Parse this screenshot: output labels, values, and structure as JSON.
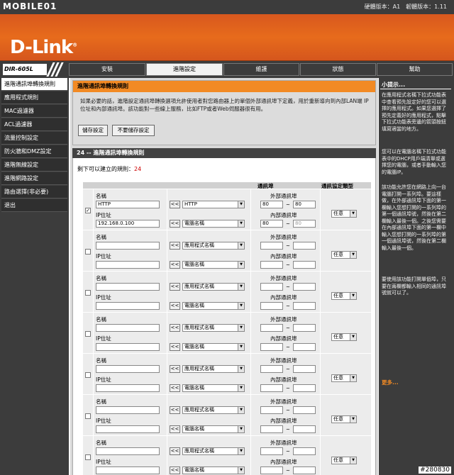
{
  "watermark": "MOBILE01",
  "version_text": "硬體版本：A1　韌體版本：1.11",
  "logo": "D-Link",
  "model": "DIR-605L",
  "tabs": [
    {
      "label": "安裝",
      "active": false
    },
    {
      "label": "進階設定",
      "active": true
    },
    {
      "label": "維護",
      "active": false
    },
    {
      "label": "狀態",
      "active": false
    },
    {
      "label": "幫助",
      "active": false
    }
  ],
  "sidebar": [
    {
      "label": "進階通訊埠轉換規則",
      "active": true
    },
    {
      "label": "應用程式規則",
      "active": false
    },
    {
      "label": "MAC過濾器",
      "active": false
    },
    {
      "label": "ACL過濾器",
      "active": false
    },
    {
      "label": "流量控制設定",
      "active": false
    },
    {
      "label": "防火牆和DMZ設定",
      "active": false
    },
    {
      "label": "進階無線設定",
      "active": false
    },
    {
      "label": "進階網路設定",
      "active": false
    },
    {
      "label": "路由選擇(非必要)",
      "active": false
    },
    {
      "label": "退出",
      "active": false
    }
  ],
  "section1": {
    "title": "進階通訊埠轉換規則",
    "text": "如果必要的話，進階設定通訊埠轉換選項允許使用者對您路由器上的單個外部通訊埠下定義，用於重新導向到內部LAN端 IP位址和內部通訊埠。該功能對一些線上服務，比如FTP或者Web伺服器很有用。",
    "save_label": "儲存設定",
    "nosave_label": "不要儲存設定"
  },
  "section2": {
    "title": "24 -- 進階通訊埠轉換規則",
    "remaining_label": "剩下可以建立的規則：",
    "remaining_count": "24",
    "head_ports": "通訊埠",
    "head_type": "通訊協定類型"
  },
  "labels": {
    "name": "名稱",
    "ip": "IP位址",
    "ext_port": "外部通訊埠",
    "int_port": "內部通訊埠",
    "arrow": "<<",
    "tilde": "~"
  },
  "rules": [
    {
      "checked": true,
      "name": "HTTP",
      "ip": "192.168.0.100",
      "app": "HTTP",
      "computer": "電腦名稱",
      "ext_start": "80",
      "ext_end": "80",
      "int_start": "80",
      "int_end": "80",
      "protocol": "任意"
    },
    {
      "checked": false,
      "name": "",
      "ip": "",
      "app": "應用程式名稱",
      "computer": "電腦名稱",
      "ext_start": "",
      "ext_end": "",
      "int_start": "",
      "int_end": "",
      "protocol": "任意"
    },
    {
      "checked": false,
      "name": "",
      "ip": "",
      "app": "應用程式名稱",
      "computer": "電腦名稱",
      "ext_start": "",
      "ext_end": "",
      "int_start": "",
      "int_end": "",
      "protocol": "任意"
    },
    {
      "checked": false,
      "name": "",
      "ip": "",
      "app": "應用程式名稱",
      "computer": "電腦名稱",
      "ext_start": "",
      "ext_end": "",
      "int_start": "",
      "int_end": "",
      "protocol": "任意"
    },
    {
      "checked": false,
      "name": "",
      "ip": "",
      "app": "應用程式名稱",
      "computer": "電腦名稱",
      "ext_start": "",
      "ext_end": "",
      "int_start": "",
      "int_end": "",
      "protocol": "任意"
    },
    {
      "checked": false,
      "name": "",
      "ip": "",
      "app": "應用程式名稱",
      "computer": "電腦名稱",
      "ext_start": "",
      "ext_end": "",
      "int_start": "",
      "int_end": "",
      "protocol": "任意"
    },
    {
      "checked": false,
      "name": "",
      "ip": "",
      "app": "應用程式名稱",
      "computer": "電腦名稱",
      "ext_start": "",
      "ext_end": "",
      "int_start": "",
      "int_end": "",
      "protocol": "任意"
    }
  ],
  "hints": {
    "title": "小提示...",
    "p1": "在應用程式名稱下拉式功能表中查看預先設定好的您可以選擇的應用程式。如果您選擇了預先定義好的應用程式，點擊下拉式功能表旁邊的箭頭按鈕填寫適當的地方。",
    "p2": "您可以在電腦名稱下拉式功能表中的DHCP用戶端清單或選擇您的電腦，或者手動輸入您的電腦IP。",
    "p3": "該功能允許您在網路上向一台電腦打開一系列埠。要這樣做，在外部通訊埠下面的第一欄輸入您想打開的一系列埠的第一個通訊埠號，然後在第二欄輸入最後一個。之後您需要在內部通訊埠下面的第一欄中輸入您想打開的一系列埠的第一個通訊埠號，然後在第二欄輸入最後一個。",
    "p4": "要使用該功能打開單個埠，只要在兩欄都輸入相同的通訊埠號就可以了。",
    "more": "更多..."
  },
  "photo_id": "#280830"
}
